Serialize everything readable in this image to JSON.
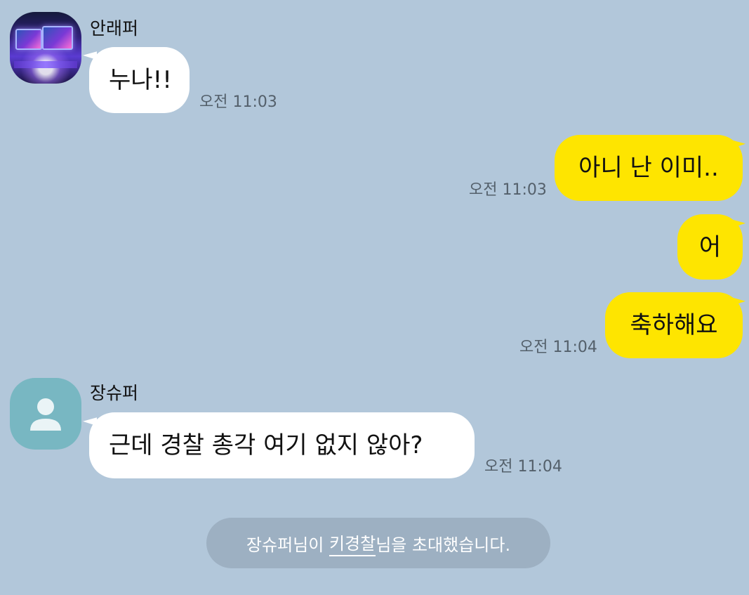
{
  "colors": {
    "background": "#b2c7da",
    "outgoing_bubble": "#fee500",
    "incoming_bubble": "#ffffff",
    "system_pill": "#9db0c2"
  },
  "messages": [
    {
      "sender": "안래퍼",
      "avatar": "photo-avatar",
      "text": "누나!!",
      "time": "오전 11:03"
    },
    {
      "direction": "out",
      "text": "아니 난 이미..",
      "time": "오전 11:03"
    },
    {
      "direction": "out",
      "text": "어"
    },
    {
      "direction": "out",
      "text": "축하해요",
      "time": "오전 11:04"
    },
    {
      "sender": "장슈퍼",
      "avatar": "default-user-icon",
      "text": "근데 경찰 총각 여기 없지 않아?",
      "time": "오전 11:04"
    }
  ],
  "system_message": {
    "prefix": "장슈퍼님이 ",
    "invitee": "키경찰",
    "suffix": "님을 초대했습니다."
  }
}
